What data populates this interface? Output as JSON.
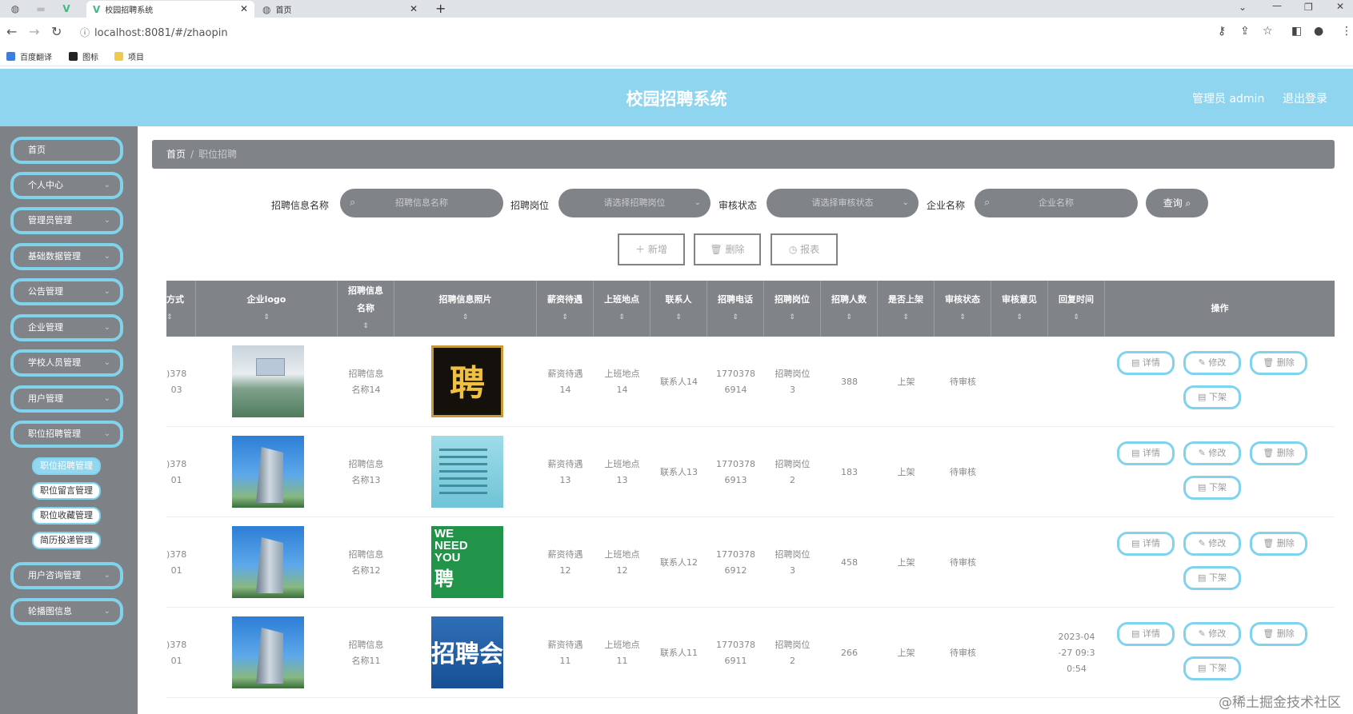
{
  "browser": {
    "tabs": [
      {
        "title": "校园招聘系统",
        "active": true
      },
      {
        "title": "首页",
        "active": false
      }
    ],
    "url": "localhost:8081/#/zhaopin",
    "bookmarks": [
      "百度翻译",
      "图标",
      "项目"
    ]
  },
  "header": {
    "title": "校园招聘系统",
    "user": "管理员 admin",
    "logout": "退出登录"
  },
  "sidebar": {
    "items": [
      {
        "label": "首页",
        "has_arrow": false
      },
      {
        "label": "个人中心",
        "has_arrow": true
      },
      {
        "label": "管理员管理",
        "has_arrow": true
      },
      {
        "label": "基础数据管理",
        "has_arrow": true
      },
      {
        "label": "公告管理",
        "has_arrow": true
      },
      {
        "label": "企业管理",
        "has_arrow": true
      },
      {
        "label": "学校人员管理",
        "has_arrow": true
      },
      {
        "label": "用户管理",
        "has_arrow": true
      },
      {
        "label": "职位招聘管理",
        "has_arrow": true
      }
    ],
    "subitems": [
      {
        "label": "职位招聘管理",
        "active": true
      },
      {
        "label": "职位留言管理",
        "active": false
      },
      {
        "label": "职位收藏管理",
        "active": false
      },
      {
        "label": "简历投递管理",
        "active": false
      }
    ],
    "items_after": [
      {
        "label": "用户咨询管理",
        "has_arrow": true
      },
      {
        "label": "轮播图信息",
        "has_arrow": true
      }
    ]
  },
  "breadcrumb": {
    "home": "首页",
    "separator": "/",
    "current": "职位招聘"
  },
  "filters": {
    "name_label": "招聘信息名称",
    "name_placeholder": "招聘信息名称",
    "post_label": "招聘岗位",
    "post_placeholder": "请选择招聘岗位",
    "status_label": "审核状态",
    "status_placeholder": "请选择审核状态",
    "company_label": "企业名称",
    "company_placeholder": "企业名称",
    "query": "查询"
  },
  "actions": {
    "add": "＋ 新增",
    "delete": "删除",
    "report": "报表"
  },
  "table": {
    "columns": [
      {
        "label": "方式",
        "sort": true
      },
      {
        "label": "企业logo",
        "sort": true
      },
      {
        "label": "招聘信息\n名称",
        "sort": true
      },
      {
        "label": "招聘信息照片",
        "sort": true
      },
      {
        "label": "薪资待遇",
        "sort": true
      },
      {
        "label": "上班地点",
        "sort": true
      },
      {
        "label": "联系人",
        "sort": true
      },
      {
        "label": "招聘电话",
        "sort": true
      },
      {
        "label": "招聘岗位",
        "sort": true
      },
      {
        "label": "招聘人数",
        "sort": true
      },
      {
        "label": "是否上架",
        "sort": true
      },
      {
        "label": "审核状态",
        "sort": true
      },
      {
        "label": "审核意见",
        "sort": true
      },
      {
        "label": "回复时间",
        "sort": true
      },
      {
        "label": "操作",
        "sort": false
      }
    ],
    "rows": [
      {
        "contact_cut": ")378\n03",
        "logo": "office",
        "name": "招聘信息\n名称14",
        "photo": "black",
        "photo_text": "聘",
        "salary": "薪资待遇\n14",
        "place": "上班地点\n14",
        "person": "联系人14",
        "phone": "1770378\n6914",
        "post": "招聘岗位\n3",
        "count": "388",
        "shelf": "上架",
        "status": "待审核",
        "opinion": "",
        "reply_time": ""
      },
      {
        "contact_cut": ")378\n01",
        "logo": "building",
        "name": "招聘信息\n名称13",
        "photo": "cyan",
        "photo_text": "",
        "salary": "薪资待遇\n13",
        "place": "上班地点\n13",
        "person": "联系人13",
        "phone": "1770378\n6913",
        "post": "招聘岗位\n2",
        "count": "183",
        "shelf": "上架",
        "status": "待审核",
        "opinion": "",
        "reply_time": ""
      },
      {
        "contact_cut": ")378\n01",
        "logo": "building",
        "name": "招聘信息\n名称12",
        "photo": "green",
        "photo_text": "WE\nNEED\nYOU",
        "photo_text2": "聘",
        "salary": "薪资待遇\n12",
        "place": "上班地点\n12",
        "person": "联系人12",
        "phone": "1770378\n6912",
        "post": "招聘岗位\n3",
        "count": "458",
        "shelf": "上架",
        "status": "待审核",
        "opinion": "",
        "reply_time": ""
      },
      {
        "contact_cut": ")378\n01",
        "logo": "building",
        "name": "招聘信息\n名称11",
        "photo": "blue",
        "photo_text": "招聘会",
        "salary": "薪资待遇\n11",
        "place": "上班地点\n11",
        "person": "联系人11",
        "phone": "1770378\n6911",
        "post": "招聘岗位\n2",
        "count": "266",
        "shelf": "上架",
        "status": "待审核",
        "opinion": "",
        "reply_time": "2023-04\n-27 09:3\n0:54"
      }
    ],
    "row_ops": {
      "detail": "详情",
      "edit": "修改",
      "delete": "删除",
      "offshelf": "下架"
    }
  },
  "watermark": "@稀土掘金技术社区",
  "colors": {
    "header": "#8fd5ef",
    "sidebar": "#7e8186",
    "accent_border": "#7fd3ec",
    "table_head": "#808388"
  },
  "icons": {
    "search": "search-icon",
    "chevron": "chevron-down-icon",
    "detail": "document-icon",
    "edit": "edit-icon",
    "delete": "trash-icon"
  }
}
